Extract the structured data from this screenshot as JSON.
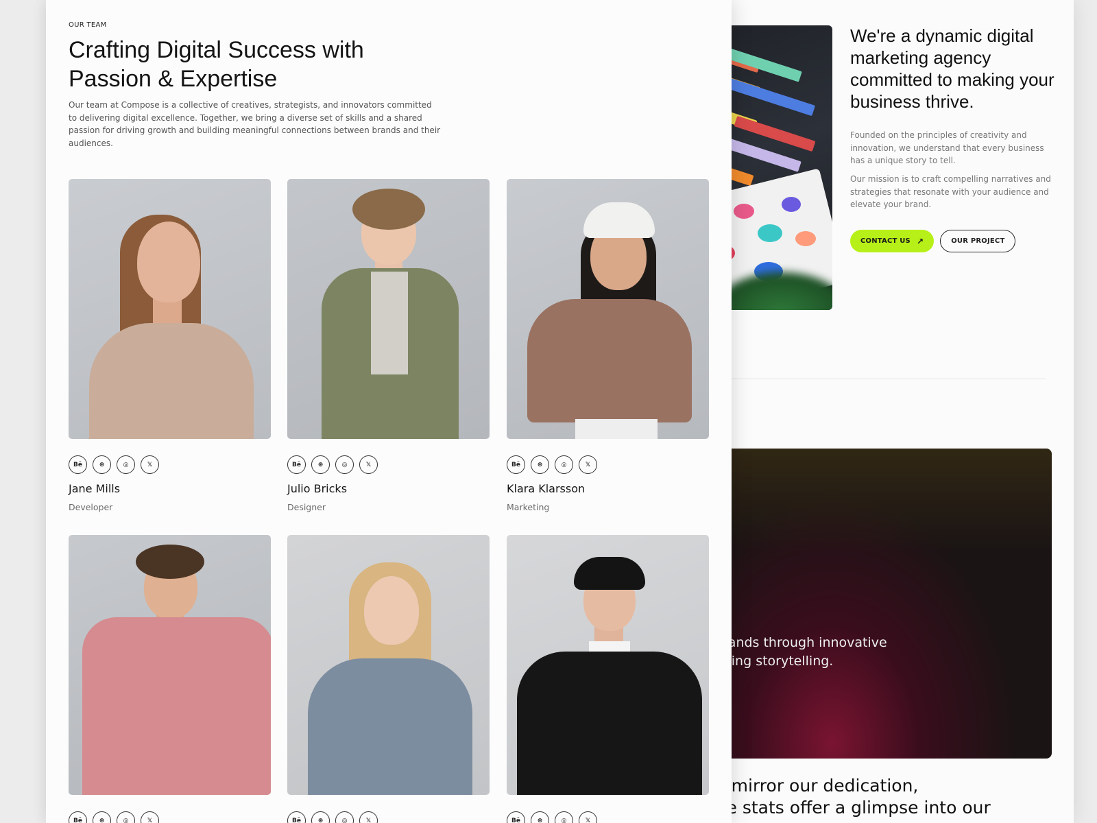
{
  "about": {
    "heading": "We're a dynamic digital marketing agency committed to making your business thrive.",
    "paragraph_1": "Founded on the principles of creativity and innovation, we understand that every business has a unique story to tell.",
    "paragraph_2": "Our mission is to craft compelling narratives and strategies that resonate with your audience and elevate your brand.",
    "contact_button": "CONTACT US",
    "project_button": "OUR PROJECT"
  },
  "video": {
    "caption": "rms brands through innovative\naptivating storytelling."
  },
  "stats": {
    "text": " that mirror our dedication,\nThese stats offer a glimpse into our"
  },
  "team": {
    "eyebrow": "OUR TEAM",
    "heading": "Crafting Digital Success with Passion & Expertise",
    "intro": "Our team at Compose is a collective of creatives, strategists, and innovators committed to delivering digital excellence. Together, we bring a diverse set of skills and a shared passion for driving growth and building meaningful connections between brands and their audiences.",
    "social_icons": [
      "behance-icon",
      "dribbble-icon",
      "instagram-icon",
      "x-icon"
    ],
    "social_labels": [
      "Bē",
      "⊛",
      "◎",
      "𝕏"
    ],
    "members": [
      {
        "name": "Jane Mills",
        "role": "Developer"
      },
      {
        "name": "Julio Bricks",
        "role": "Designer"
      },
      {
        "name": "Klara Klarsson",
        "role": "Marketing"
      },
      {
        "name": "",
        "role": ""
      },
      {
        "name": "",
        "role": ""
      },
      {
        "name": "",
        "role": ""
      }
    ]
  },
  "colors": {
    "accent": "#b7f018",
    "page_bg": "#fcfcfc",
    "text": "#141414"
  }
}
